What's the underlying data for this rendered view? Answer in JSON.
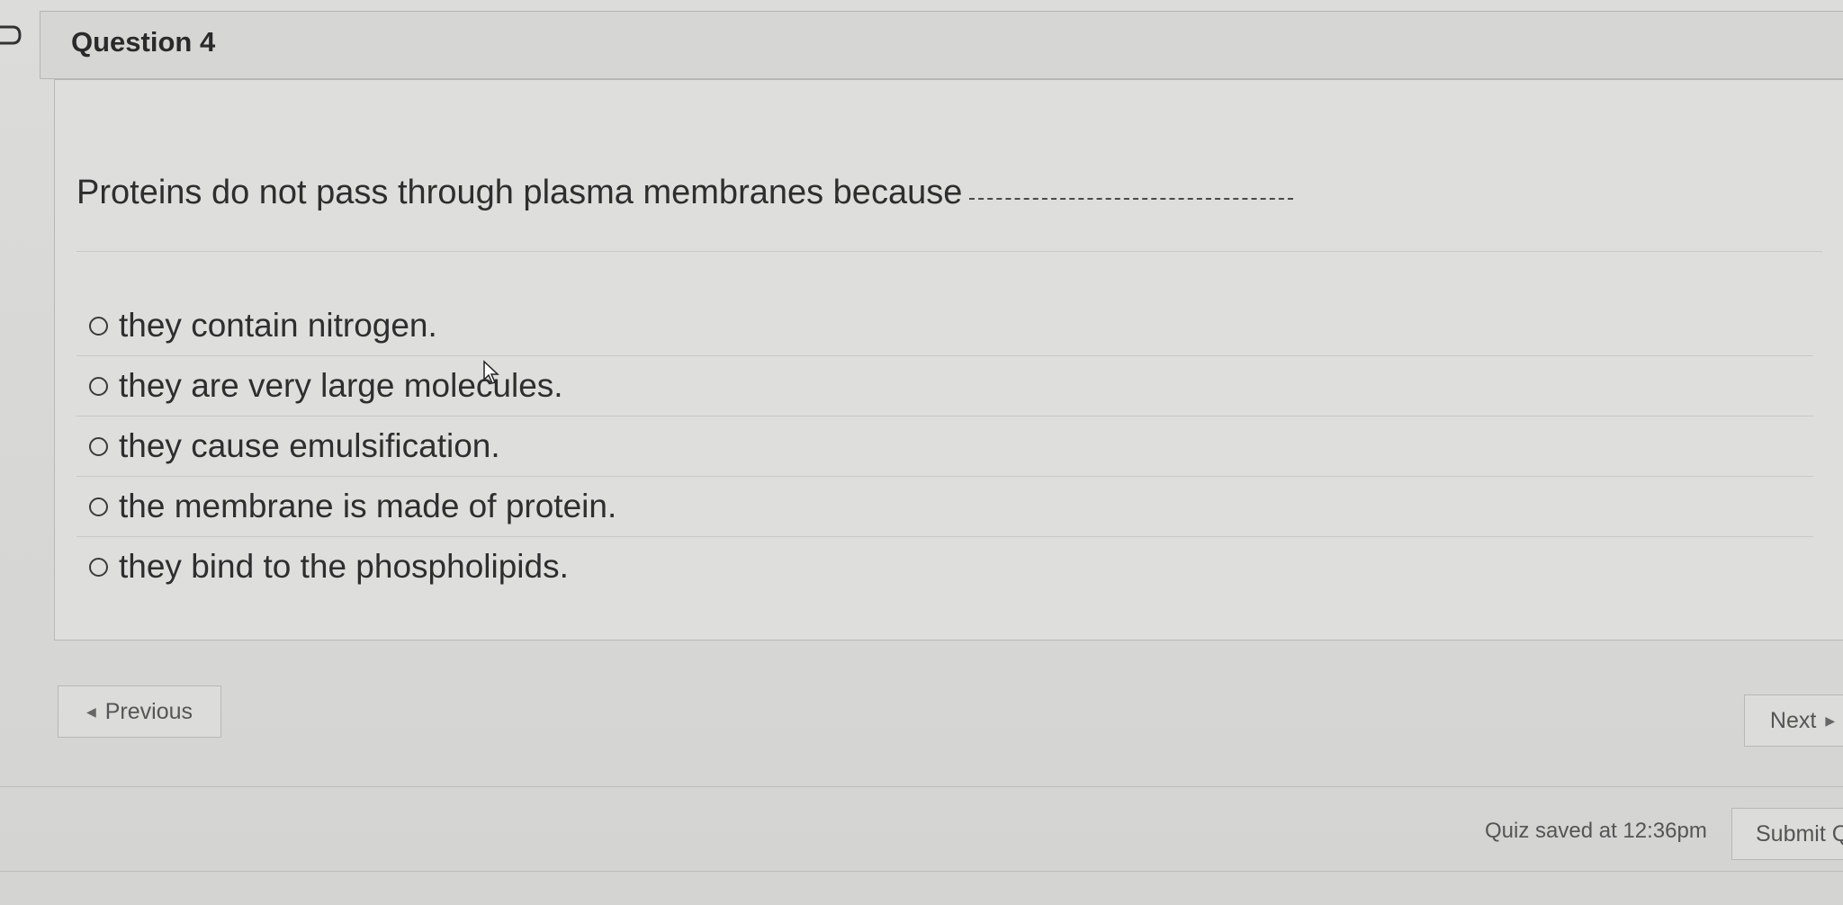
{
  "header": {
    "title": "Question 4"
  },
  "question": {
    "text": "Proteins do not pass through plasma membranes because"
  },
  "options": [
    {
      "label": "they contain nitrogen."
    },
    {
      "label": "they are very large molecules."
    },
    {
      "label": "they cause emulsification."
    },
    {
      "label": "the membrane is made of protein."
    },
    {
      "label": "they bind to the phospholipids."
    }
  ],
  "nav": {
    "previous_label": "Previous",
    "next_label": "Next"
  },
  "footer": {
    "status": "Quiz saved at 12:36pm",
    "submit_label": "Submit Q"
  },
  "icons": {
    "left_marker": "bookmark-flag-icon",
    "previous": "triangle-left-icon",
    "next": "triangle-right-icon",
    "cursor": "mouse-pointer-icon"
  },
  "colors": {
    "background": "#d8d8d6",
    "panel": "#dededc",
    "text": "#2e2e2e",
    "border": "#b8b8b6"
  }
}
